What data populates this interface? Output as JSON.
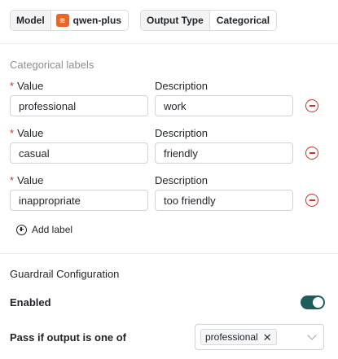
{
  "header": {
    "model_key": "Model",
    "model_value": "qwen-plus",
    "output_key": "Output Type",
    "output_value": "Categorical"
  },
  "labels_section": {
    "title": "Categorical labels",
    "value_label": "Value",
    "description_label": "Description",
    "required_mark": "*",
    "rows": [
      {
        "value": "professional",
        "description": "work"
      },
      {
        "value": "casual",
        "description": "friendly"
      },
      {
        "value": "inappropriate",
        "description": "too friendly"
      }
    ],
    "add_label": "Add label"
  },
  "guardrail": {
    "title": "Guardrail Configuration",
    "enabled_label": "Enabled",
    "enabled": true,
    "pass_label": "Pass if output is one of",
    "selected": [
      "professional"
    ],
    "tag_remove_glyph": "✕"
  },
  "colors": {
    "accent_toggle": "#1f5c5c",
    "danger": "#d2302f",
    "model_logo": "#e8662a"
  }
}
